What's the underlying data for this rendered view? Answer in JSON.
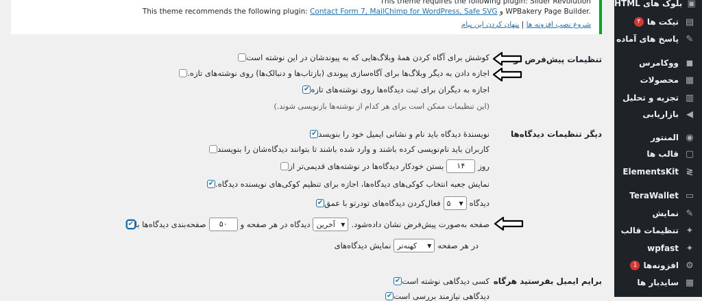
{
  "sidebar": {
    "items": [
      {
        "label": "بلوک های HTML",
        "icon": "html-blocks-icon",
        "glyph": "▣"
      },
      {
        "label": "تیکت ها",
        "icon": "tickets-icon",
        "glyph": "▤",
        "badge": "۴"
      },
      {
        "label": "پاسخ های آماده",
        "icon": "pin-icon",
        "glyph": "✎"
      },
      {
        "label": "ووکامرس",
        "icon": "woocommerce-icon",
        "glyph": "◼"
      },
      {
        "label": "محصولات",
        "icon": "products-icon",
        "glyph": "▦"
      },
      {
        "label": "تجزیه و تحلیل",
        "icon": "analytics-icon",
        "glyph": "▥"
      },
      {
        "label": "بازاریابی",
        "icon": "marketing-icon",
        "glyph": "◀"
      },
      {
        "label": "المنتور",
        "icon": "elementor-icon",
        "glyph": "◉"
      },
      {
        "label": "قالب ها",
        "icon": "templates-icon",
        "glyph": "▢"
      },
      {
        "label": "ElementsKit",
        "icon": "elementskit-icon",
        "glyph": "≷"
      },
      {
        "label": "TeraWallet",
        "icon": "wallet-icon",
        "glyph": "▭"
      },
      {
        "label": "نمایش",
        "icon": "appearance-icon",
        "glyph": "✎"
      },
      {
        "label": "تنظیمات قالب",
        "icon": "theme-settings-icon",
        "glyph": "✦"
      },
      {
        "label": "wpfast",
        "icon": "wpfast-icon",
        "glyph": "✦"
      },
      {
        "label": "افزونه‌ها",
        "icon": "plugins-icon",
        "glyph": "⚙",
        "badge": "1"
      },
      {
        "label": "سایدبار ها",
        "icon": "sidebars-icon",
        "glyph": "▦"
      }
    ]
  },
  "notice": {
    "line1": "This theme requires the following plugin: Slider Revolution",
    "line2_prefix": "This theme recommends the following plugin: ",
    "line2_links": "Contact Form 7, MailChimp for WordPress, Safe SVG",
    "line2_suffix": " و WPBakery Page Builder.",
    "install_link": "شروع نصب افزونه ها",
    "separator": " | ",
    "dismiss_link": "پنهان کردن این پیام"
  },
  "sections": {
    "default_post": "تنظیمات پیش‌فرض نوشته",
    "other_comments": "دیگر تنظیمات دیدگاه‌ها",
    "email_me": "برایم ایمیل بفرستید هرگاه"
  },
  "options": {
    "notify_linked": "کوشش برای آگاه کردن همهٔ وبلاگ‌هایی که به پیوندشان در این نوشته است",
    "allow_pings": "اجازه دادن به دیگر وبلاگ‌ها برای آگاه‌سازی پیوندی (بازتاب‌ها و دنبالک‌ها) روی نوشته‌های تازه.",
    "allow_comments": "اجازه به دیگران برای ثبت دیدگاه‌ها روی نوشته‌های تازه",
    "override_note": "(این تنظیمات ممکن است برای هر کدام از نوشته‌ها بازنویسی شوند.)",
    "require_name_email": "نویسندهٔ دیدگاه باید نام و نشانی ایمیل خود را بنویسد",
    "registration_required": "کاربران باید نام‌نویسی کرده باشند و وارد شده باشند تا بتوانند دیدگاه‌شان را بنویسند",
    "close_comments_before": "بستن خودکار دیدگاه‌ها در نوشته‌های قدیمی‌تر از",
    "close_days_value": "۱۴",
    "close_days_unit": "روز",
    "cookies_optin": "نمایش جعبه انتخاب کوکی‌های دیدگاه‌ها، اجازه برای تنظیم کوکی‌های نویسنده دیدگاه.",
    "threaded_before": "فعال‌کردن دیدگاه‌های تودرتو با عمق",
    "thread_depth": "۵",
    "threaded_after": "دیدگاه",
    "paginate_before": "صفحه‌بندی دیدگاه‌ها با",
    "per_page_value": "۵۰",
    "paginate_middle": "دیدگاه در هر صفحه و",
    "default_page": "آخرین",
    "paginate_after": "صفحه به‌صورت پیش‌فرض نشان داده‌شود.",
    "display_before": "نمایش دیدگاه‌های",
    "display_order": "کهنه‌تر",
    "display_after": "در هر صفحه",
    "anyone_posts": "کسی دیدگاهی نوشته است",
    "held_moderation": "دیدگاهی نیازمند بررسی است"
  }
}
